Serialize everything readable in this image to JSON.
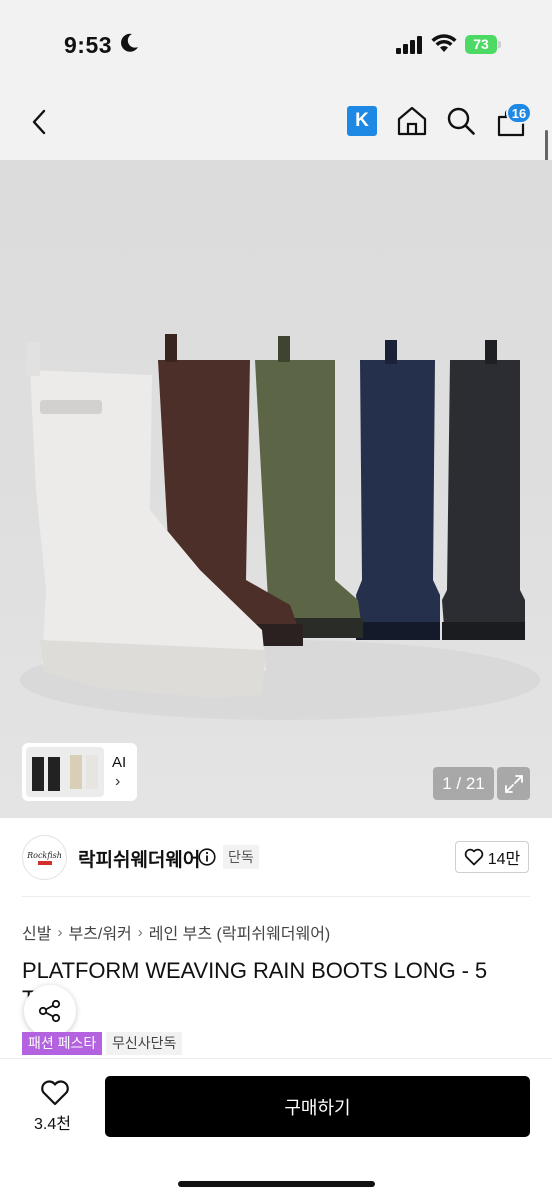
{
  "status_bar": {
    "time": "9:53",
    "battery": "73"
  },
  "nav": {
    "k_badge": "K",
    "cart_count": "16"
  },
  "gallery": {
    "ai_label": "AI",
    "ai_arrow": "›",
    "counter": "1 / 21"
  },
  "brand": {
    "name": "락피쉬웨더웨어",
    "exclusive": "단독",
    "like_count": "14만",
    "logo_text": "Rockfish"
  },
  "breadcrumb": [
    "신발",
    "부츠/워커",
    "레인 부츠 (락피쉬웨더웨어)"
  ],
  "product": {
    "title": "PLATFORM WEAVING RAIN BOOTS LONG - 5",
    "title_line2": "T"
  },
  "badges": {
    "festa": "패션 페스타",
    "exclusive": "무신사단독"
  },
  "bottom": {
    "wish_count": "3.4천",
    "buy_label": "구매하기"
  },
  "colors": {
    "accent_blue": "#1e88e5",
    "festa_purple": "#b362e0",
    "buy_black": "#000000"
  },
  "icons": [
    "moon-icon",
    "signal-icon",
    "wifi-icon",
    "back-icon",
    "home-icon",
    "search-icon",
    "bag-icon",
    "expand-icon",
    "info-icon",
    "heart-icon",
    "share-icon"
  ]
}
